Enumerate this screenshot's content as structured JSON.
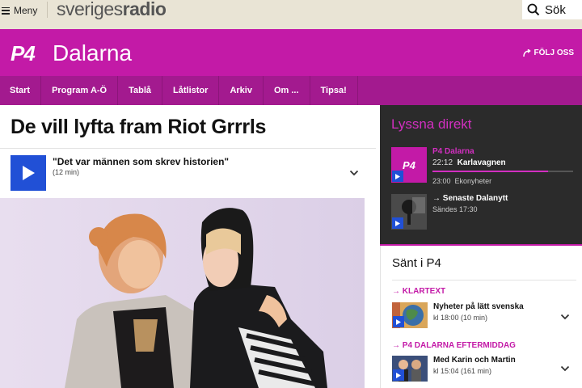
{
  "topbar": {
    "menu_label": "Meny",
    "brand_text": "sveriges",
    "brand_bold": "radio",
    "search_label": "Sök"
  },
  "banner": {
    "logo_text": "P4",
    "channel_title": "Dalarna",
    "follow_label": "FÖLJ OSS"
  },
  "nav": {
    "items": [
      {
        "label": "Start"
      },
      {
        "label": "Program A-Ö"
      },
      {
        "label": "Tablå"
      },
      {
        "label": "Låtlistor"
      },
      {
        "label": "Arkiv"
      },
      {
        "label": "Om ..."
      },
      {
        "label": "Tipsa!"
      }
    ]
  },
  "article": {
    "headline": "De vill lyfta fram Riot Grrrls",
    "clip": {
      "title": "\"Det var männen som skrev historien\"",
      "duration": "(12 min)"
    }
  },
  "live": {
    "title": "Lyssna direkt",
    "channel": {
      "logo_text": "P4",
      "name": "P4 Dalarna",
      "now_time": "22:12",
      "now_title": "Karlavagnen",
      "progress": 0.82,
      "next_time": "23:00",
      "next_title": "Ekonyheter"
    },
    "news": {
      "title": "→ Senaste Dalanytt",
      "subtitle": "Sändes 17:30"
    }
  },
  "sent": {
    "title": "Sänt i P4",
    "items": [
      {
        "program": "→ KLARTEXT",
        "title": "Nyheter på lätt svenska",
        "meta": "kl 18:00  (10 min)"
      },
      {
        "program": "→ P4 DALARNA EFTERMIDDAG",
        "title": "Med Karin och Martin",
        "meta": "kl 15:04  (161 min)"
      }
    ]
  },
  "colors": {
    "brand_magenta": "#c31aa7",
    "nav_magenta": "#a31a8f",
    "play_blue": "#2150d6",
    "live_bg": "#2b2b2b"
  }
}
